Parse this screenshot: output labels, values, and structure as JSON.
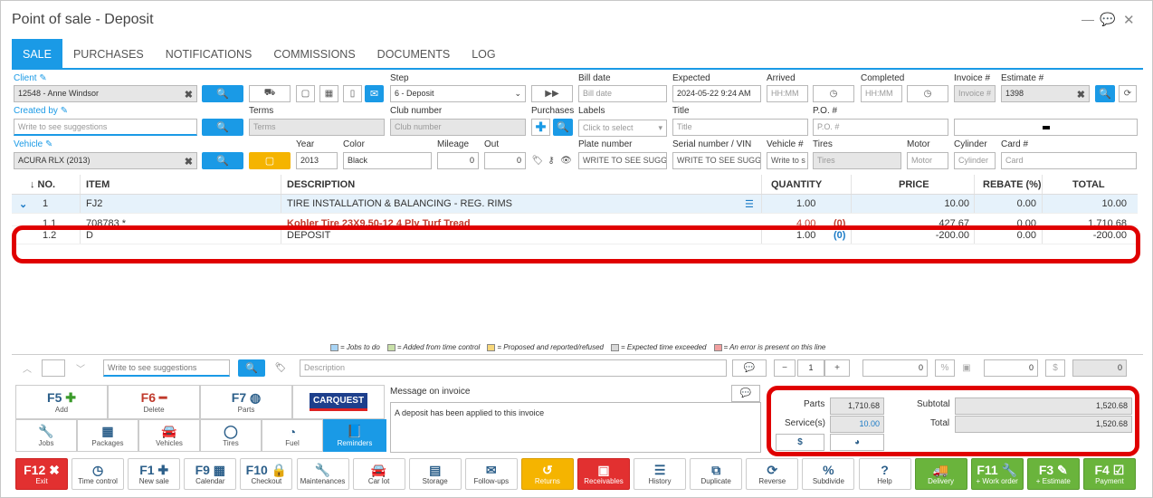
{
  "window": {
    "title": "Point of sale - Deposit",
    "icons": [
      "minimize-icon",
      "chat-icon",
      "close-icon"
    ]
  },
  "tabs": [
    "SALE",
    "PURCHASES",
    "NOTIFICATIONS",
    "COMMISSIONS",
    "DOCUMENTS",
    "LOG"
  ],
  "form": {
    "client": {
      "label": "Client",
      "value": "12548 - Anne Windsor"
    },
    "created_by": {
      "label": "Created by",
      "placeholder": "Write to see suggestions"
    },
    "vehicle": {
      "label": "Vehicle",
      "value": "ACURA RLX (2013)"
    },
    "step": {
      "label": "Step",
      "value": "6 - Deposit"
    },
    "terms": {
      "label": "Terms",
      "placeholder": "Terms"
    },
    "club": {
      "label": "Club number",
      "placeholder": "Club number"
    },
    "purchases": {
      "label": "Purchases"
    },
    "bill_date": {
      "label": "Bill date",
      "placeholder": "Bill date"
    },
    "labels": {
      "label": "Labels",
      "placeholder": "Click to select"
    },
    "expected": {
      "label": "Expected",
      "value": "2024-05-22 9:24 AM"
    },
    "title": {
      "label": "Title",
      "placeholder": "Title"
    },
    "arrived": {
      "label": "Arrived",
      "placeholder": "HH:MM"
    },
    "completed": {
      "label": "Completed",
      "placeholder": "HH:MM"
    },
    "po": {
      "label": "P.O. #",
      "placeholder": "P.O. #"
    },
    "invoice": {
      "label": "Invoice #",
      "placeholder": "Invoice #"
    },
    "estimate": {
      "label": "Estimate #",
      "value": "1398"
    },
    "carfax": "CARFAX",
    "year": {
      "label": "Year",
      "value": "2013"
    },
    "color": {
      "label": "Color",
      "value": "Black"
    },
    "mileage": {
      "label": "Mileage",
      "value": "0"
    },
    "out": {
      "label": "Out",
      "value": "0"
    },
    "plate": {
      "label": "Plate number",
      "placeholder": "WRITE TO SEE SUGGE"
    },
    "serial": {
      "label": "Serial number / VIN",
      "placeholder": "WRITE TO SEE SUGGE"
    },
    "vehicle_no": {
      "label": "Vehicle #",
      "placeholder": "Write to s"
    },
    "tires": {
      "label": "Tires",
      "placeholder": "Tires"
    },
    "motor": {
      "label": "Motor",
      "placeholder": "Motor"
    },
    "cylinder": {
      "label": "Cylinder",
      "placeholder": "Cylinder"
    },
    "card": {
      "label": "Card #",
      "placeholder": "Card"
    }
  },
  "table": {
    "headers": [
      "↓ NO.",
      "ITEM",
      "DESCRIPTION",
      "QUANTITY",
      "PRICE",
      "REBATE (%)",
      "TOTAL"
    ],
    "rows": [
      {
        "no": "1",
        "item": "FJ2",
        "desc": "TIRE INSTALLATION & BALANCING - REG. RIMS",
        "qty": "1.00",
        "zero": "",
        "price": "10.00",
        "rebate": "0.00",
        "total": "10.00"
      },
      {
        "no": "1.1",
        "item": "708783 *",
        "desc": "Kohler Tire 23X9.50-12 4 Ply Turf Tread",
        "qty": "4.00",
        "zero": "(0)",
        "price": "427.67",
        "rebate": "0.00",
        "total": "1,710.68"
      },
      {
        "no": "1.2",
        "item": "D",
        "desc": "DEPOSIT",
        "qty": "1.00",
        "zero": "(0)",
        "price": "-200.00",
        "rebate": "0.00",
        "total": "-200.00"
      }
    ]
  },
  "legend": [
    "= Jobs to do",
    "= Added from time control",
    "= Proposed and reported/refused",
    "= Expected time exceeded",
    "= An error is present on this line"
  ],
  "legend_colors": [
    "#a8d4f5",
    "#c8e0a8",
    "#f7d77a",
    "#d8d8d8",
    "#f2a0a0"
  ],
  "entry": {
    "search_placeholder": "Write to see suggestions",
    "desc_placeholder": "Description",
    "qty": "1",
    "v1": "0",
    "v2": "0",
    "v3": "0"
  },
  "fkeys": [
    {
      "key": "F5",
      "label": "Add"
    },
    {
      "key": "F6",
      "label": "Delete"
    },
    {
      "key": "F7",
      "label": "Parts"
    }
  ],
  "carquest": "CARQUEST",
  "modules": [
    "Jobs",
    "Packages",
    "Vehicles",
    "Tires",
    "Fuel",
    "Reminders"
  ],
  "message": {
    "label": "Message on invoice",
    "text": "A deposit has been applied to this invoice"
  },
  "totals": {
    "parts_label": "Parts",
    "parts": "1,710.68",
    "service_label": "Service(s)",
    "service": "10.00",
    "subtotal_label": "Subtotal",
    "subtotal": "1,520.68",
    "total_label": "Total",
    "total": "1,520.68"
  },
  "bottom": [
    {
      "ic": "F12 ✖",
      "label": "Exit"
    },
    {
      "ic": "◷",
      "label": "Time control"
    },
    {
      "ic": "F1 ✚",
      "label": "New sale"
    },
    {
      "ic": "F9 ▦",
      "label": "Calendar"
    },
    {
      "ic": "F10 🔒",
      "label": "Checkout"
    },
    {
      "ic": "🔧",
      "label": "Maintenances"
    },
    {
      "ic": "🚘",
      "label": "Car lot"
    },
    {
      "ic": "▤",
      "label": "Storage"
    },
    {
      "ic": "✉",
      "label": "Follow-ups"
    },
    {
      "ic": "↺",
      "label": "Returns"
    },
    {
      "ic": "▣",
      "label": "Receivables"
    },
    {
      "ic": "☰",
      "label": "History"
    },
    {
      "ic": "⧉",
      "label": "Duplicate"
    },
    {
      "ic": "⟳",
      "label": "Reverse"
    },
    {
      "ic": "%",
      "label": "Subdivide"
    },
    {
      "ic": "?",
      "label": "Help"
    },
    {
      "ic": "🚚",
      "label": "Delivery"
    },
    {
      "ic": "F11 🔧",
      "label": "+ Work order"
    },
    {
      "ic": "F3 ✎",
      "label": "+ Estimate"
    },
    {
      "ic": "F4 ☑",
      "label": "Payment"
    }
  ]
}
